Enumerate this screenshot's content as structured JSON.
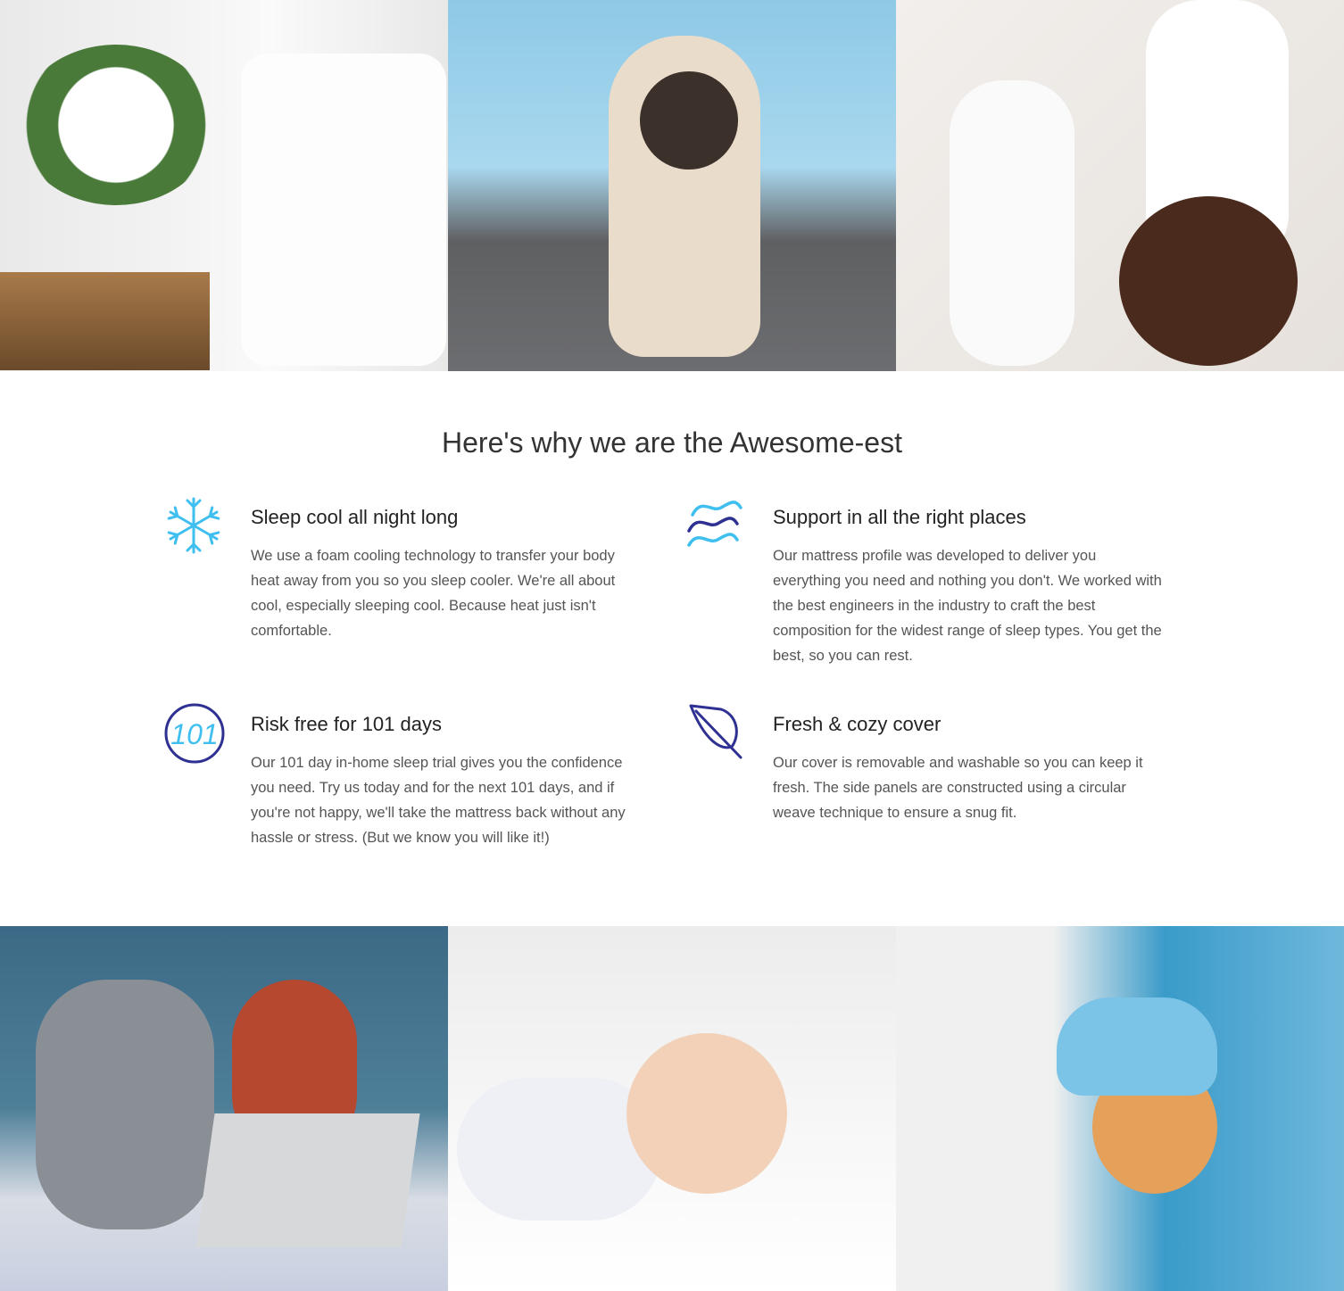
{
  "heading": "Here's why we are the Awesome-est",
  "features": [
    {
      "icon": "snowflake-icon",
      "title": "Sleep cool all night long",
      "body": "We use a foam cooling technology to transfer your body heat away from you so you sleep cooler. We're all about cool, especially sleeping cool. Because heat just isn't comfortable."
    },
    {
      "icon": "waves-icon",
      "title": "Support in all the right places",
      "body": "Our mattress profile was developed to deliver you everything you need and nothing you don't. We worked with the best engineers in the industry to craft the best composition for the widest range of sleep types. You get the best, so you can rest."
    },
    {
      "icon": "101-days-badge-icon",
      "badge_text": "101",
      "title": "Risk free for 101 days",
      "body": "Our 101 day in-home sleep trial gives you the confidence you need. Try us today and for the next 101 days, and if you're not happy, we'll take the mattress back without any hassle or stress. (But we know you will like it!)"
    },
    {
      "icon": "leaf-icon",
      "title": "Fresh & cozy cover",
      "body": "Our cover is removable and washable so you can keep it fresh. The side panels are constructed using a circular weave technique to ensure a snug fit."
    }
  ],
  "colors": {
    "light_blue": "#3fbfef",
    "navy": "#2e3192",
    "text": "#555555"
  }
}
